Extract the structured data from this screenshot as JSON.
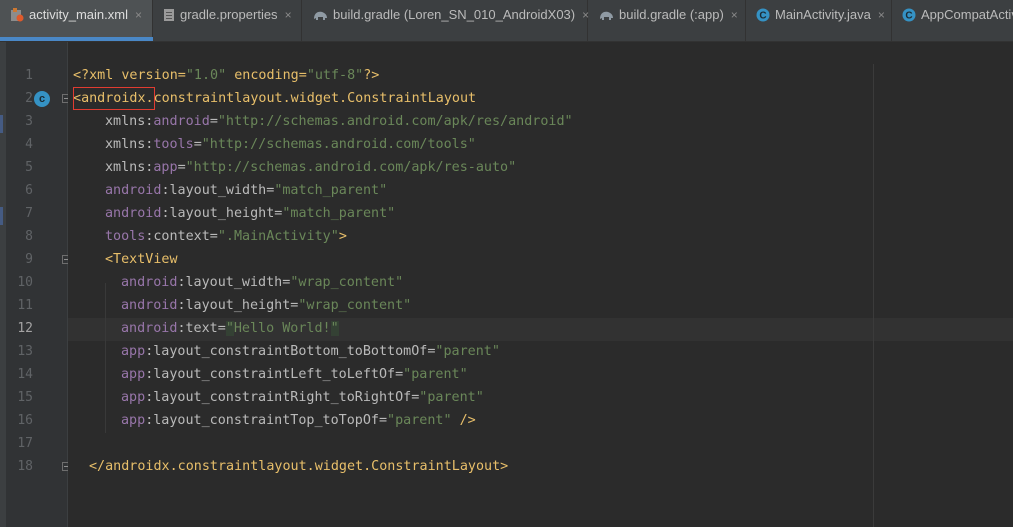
{
  "tabs": [
    {
      "label": "activity_main.xml",
      "icon": "xml-layout-icon",
      "active": true
    },
    {
      "label": "gradle.properties",
      "icon": "properties-file-icon",
      "active": false
    },
    {
      "label": "build.gradle (Loren_SN_010_AndroidX03)",
      "icon": "gradle-elephant-icon",
      "active": false
    },
    {
      "label": "build.gradle (:app)",
      "icon": "gradle-elephant-icon",
      "active": false
    },
    {
      "label": "MainActivity.java",
      "icon": "java-class-icon",
      "active": false
    },
    {
      "label": "AppCompatActiv",
      "icon": "java-class-icon",
      "active": false
    }
  ],
  "tab_close_glyph": "×",
  "gutter": {
    "line_numbers": [
      "1",
      "2",
      "3",
      "4",
      "5",
      "6",
      "7",
      "8",
      "9",
      "10",
      "11",
      "12",
      "13",
      "14",
      "15",
      "16",
      "17",
      "18"
    ],
    "current_line": "12",
    "class_icon_letter": "c"
  },
  "code": {
    "l1": [
      "<?xml version=",
      "\"1.0\"",
      " encoding=",
      "\"utf-8\"",
      "?>"
    ],
    "l2": [
      "<",
      "androidx.",
      "constraintlayout.widget.ConstraintLayout"
    ],
    "l3": [
      "xmlns:",
      "android",
      "=",
      "\"http://schemas.android.com/apk/res/android\""
    ],
    "l4": [
      "xmlns:",
      "tools",
      "=",
      "\"http://schemas.android.com/tools\""
    ],
    "l5": [
      "xmlns:",
      "app",
      "=",
      "\"http://schemas.android.com/apk/res-auto\""
    ],
    "l6": [
      "android",
      ":layout_width=",
      "\"match_parent\""
    ],
    "l7": [
      "android",
      ":layout_height=",
      "\"match_parent\""
    ],
    "l8": [
      "tools",
      ":context=",
      "\".MainActivity\"",
      ">"
    ],
    "l9": [
      "<TextView"
    ],
    "l10": [
      "android",
      ":layout_width=",
      "\"wrap_content\""
    ],
    "l11": [
      "android",
      ":layout_height=",
      "\"wrap_content\""
    ],
    "l12": [
      "android",
      ":text=",
      "\"",
      "Hello World!",
      "\""
    ],
    "l13": [
      "app",
      ":layout_constraintBottom_toBottomOf=",
      "\"parent\""
    ],
    "l14": [
      "app",
      ":layout_constraintLeft_toLeftOf=",
      "\"parent\""
    ],
    "l15": [
      "app",
      ":layout_constraintRight_toRightOf=",
      "\"parent\""
    ],
    "l16": [
      "app",
      ":layout_constraintTop_toTopOf=",
      "\"parent\"",
      " />"
    ],
    "l18": [
      "</androidx.constraintlayout.widget.ConstraintLayout>"
    ]
  }
}
